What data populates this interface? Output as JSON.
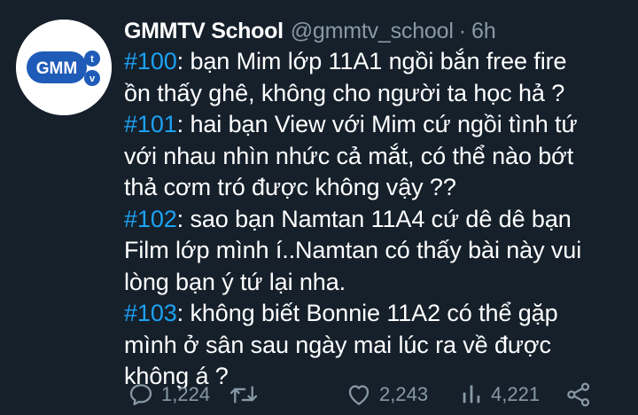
{
  "tweet": {
    "author_name": "GMMTV School",
    "author_handle": "@gmmtv_school",
    "separator": "·",
    "time": "6h",
    "avatar_logo_text": "GMM",
    "lines": [
      {
        "tag": "#100",
        "text": ": bạn Mim lớp 11A1 ngồi bắn free fire"
      },
      {
        "tag": "",
        "text": "ồn thấy ghê, không cho người ta học hả ?"
      },
      {
        "tag": "#101",
        "text": ": hai bạn View với Mim cứ ngồi tình tứ"
      },
      {
        "tag": "",
        "text": "với nhau nhìn nhức cả mắt, có thể nào bớt"
      },
      {
        "tag": "",
        "text": "thả cơm tró được không vậy ??"
      },
      {
        "tag": "#102",
        "text": ": sao bạn Namtan 11A4 cứ dê dê bạn"
      },
      {
        "tag": "",
        "text": "Film lớp mình í..Namtan có thấy bài này vui"
      },
      {
        "tag": "",
        "text": "lòng bạn ý tứ lại nha."
      },
      {
        "tag": "#103",
        "text": ": không biết Bonnie 11A2 có thể gặp"
      },
      {
        "tag": "",
        "text": "mình ở sân sau ngày mai lúc ra về được"
      },
      {
        "tag": "",
        "text": "không á ?"
      }
    ]
  },
  "actions": {
    "reply": {
      "icon": "reply-icon",
      "count": "1,224"
    },
    "retweet": {
      "icon": "retweet-icon",
      "count": ""
    },
    "like": {
      "icon": "heart-icon",
      "count": "2,243"
    },
    "views": {
      "icon": "analytics-icon",
      "count": "4,221"
    },
    "share": {
      "icon": "share-icon"
    }
  },
  "colors": {
    "background": "#15202b",
    "text": "#ffffff",
    "secondary": "#8899a6",
    "hashtag": "#1da1f2",
    "logo_blue": "#1f5bb8"
  }
}
